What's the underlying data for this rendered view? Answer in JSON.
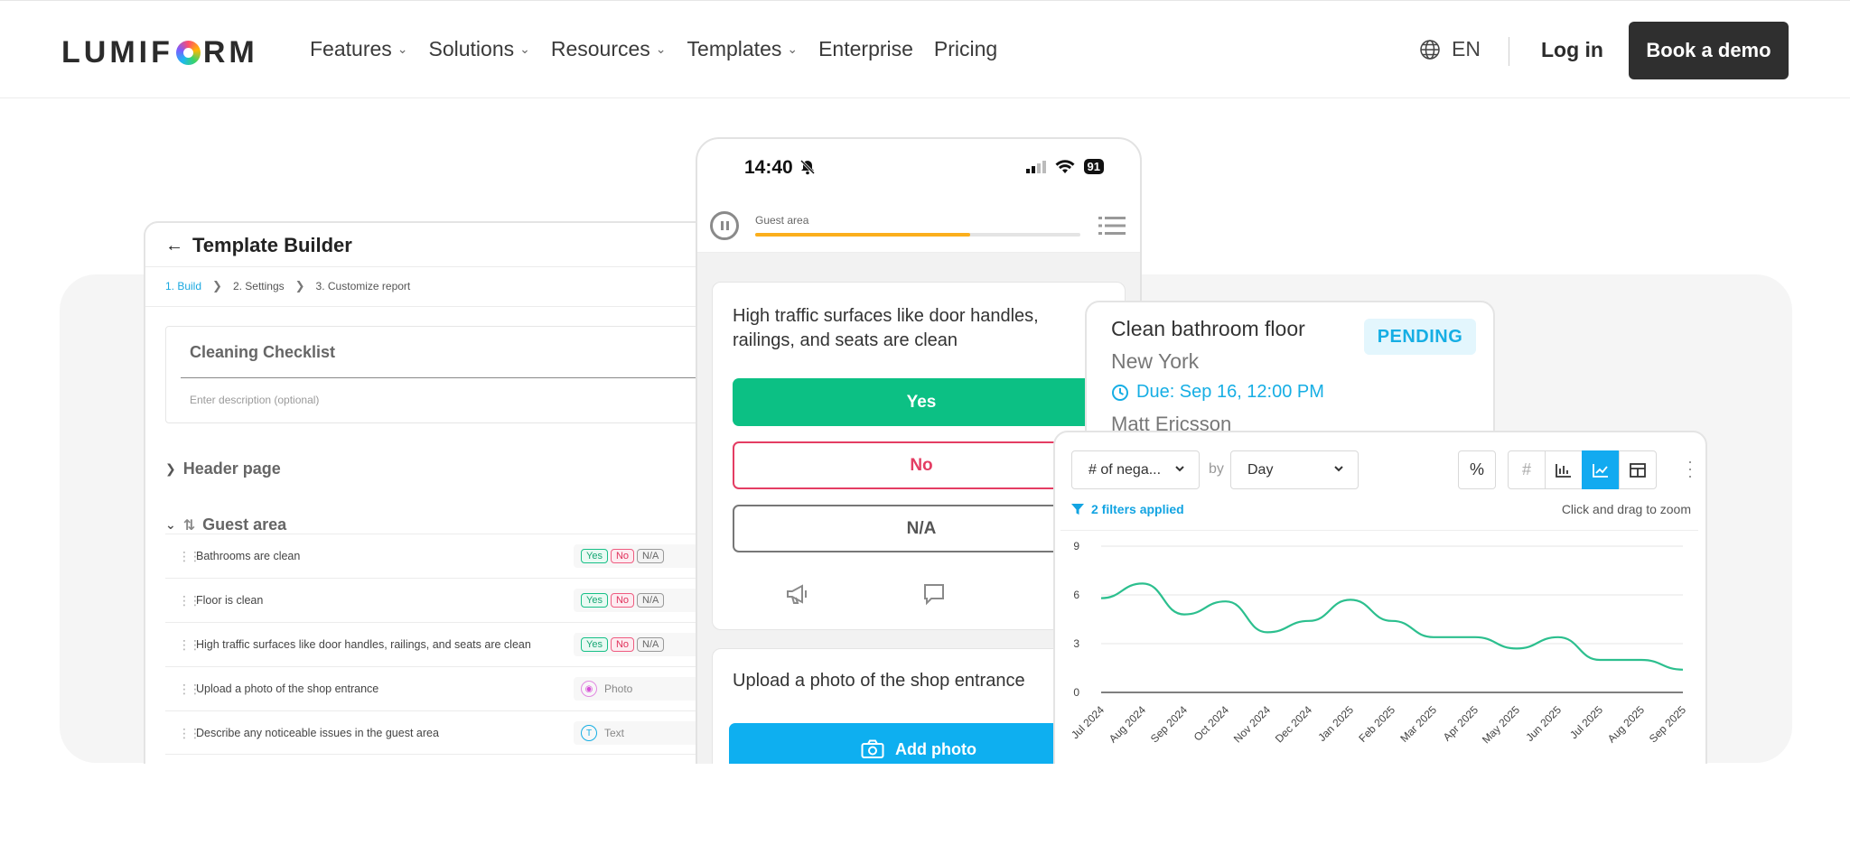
{
  "brand": {
    "logo_pre": "LUMIF",
    "logo_post": "RM"
  },
  "nav": [
    {
      "label": "Features",
      "dropdown": true
    },
    {
      "label": "Solutions",
      "dropdown": true
    },
    {
      "label": "Resources",
      "dropdown": true
    },
    {
      "label": "Templates",
      "dropdown": true
    },
    {
      "label": "Enterprise",
      "dropdown": false
    },
    {
      "label": "Pricing",
      "dropdown": false
    }
  ],
  "header": {
    "lang": "EN",
    "login": "Log in",
    "demo": "Book a demo"
  },
  "builder": {
    "title": "Template Builder",
    "steps": [
      "1. Build",
      "2. Settings",
      "3. Customize report"
    ],
    "checklist_name": "Cleaning Checklist",
    "description_placeholder": "Enter description (optional)",
    "section_header": "Header page",
    "section_guest": "Guest area",
    "answer_yes": "Yes",
    "answer_no": "No",
    "answer_na": "N/A",
    "type_photo": "Photo",
    "type_text": "Text",
    "type_text_icon": "T",
    "items": [
      "Bathrooms are clean",
      "Floor is clean",
      "High traffic surfaces like door handles, railings, and seats are clean",
      "Upload a photo of the shop entrance",
      "Describe any noticeable issues in the guest area"
    ]
  },
  "phone": {
    "time": "14:40",
    "battery": "91",
    "area": "Guest area",
    "progress": 0.66,
    "question1": "High traffic surfaces like door handles, railings, and seats are clean",
    "yes": "Yes",
    "no": "No",
    "na": "N/A",
    "question2": "Upload a photo of the shop entrance",
    "add_photo": "Add photo"
  },
  "task": {
    "title": "Clean bathroom floor",
    "location": "New York",
    "due": "Due: Sep 16, 12:00 PM",
    "assignee": "Matt Ericsson",
    "status": "PENDING"
  },
  "analytics": {
    "metric": "# of nega...",
    "by": "by",
    "period": "Day",
    "filters": "2 filters applied",
    "zoom_hint": "Click and drag to zoom",
    "percent_icon": "%",
    "hash_icon": "#"
  },
  "chart_data": {
    "type": "line",
    "x": [
      "Jul 2024",
      "Aug 2024",
      "Sep 2024",
      "Oct 2024",
      "Nov 2024",
      "Dec 2024",
      "Jan 2025",
      "Feb 2025",
      "Mar 2025",
      "Apr 2025",
      "May 2025",
      "Jun 2025",
      "Jul 2025",
      "Aug 2025",
      "Sep 2025"
    ],
    "y": [
      5.8,
      6.7,
      4.8,
      5.6,
      3.7,
      4.4,
      5.7,
      4.4,
      3.4,
      3.4,
      2.7,
      3.4,
      2.0,
      2.0,
      1.4
    ],
    "yticks": [
      0,
      3,
      6,
      9
    ],
    "ylim": [
      0,
      9
    ],
    "color": "#2cbf8e",
    "grid": true
  }
}
